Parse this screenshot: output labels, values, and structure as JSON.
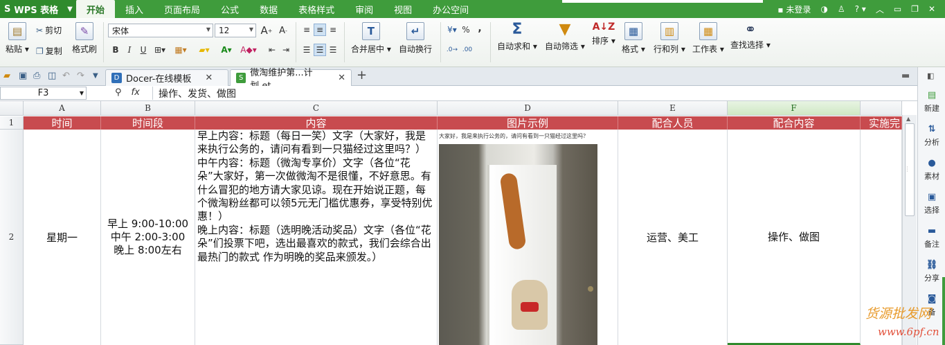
{
  "app": {
    "logo": "S",
    "name": "WPS 表格"
  },
  "menu": {
    "tabs": [
      "开始",
      "插入",
      "页面布局",
      "公式",
      "数据",
      "表格样式",
      "审阅",
      "视图",
      "办公空间"
    ],
    "active_index": 0,
    "login": "未登录",
    "help": "?"
  },
  "ribbon": {
    "paste": "粘贴",
    "cut": "剪切",
    "copy": "复制",
    "format_painter": "格式刷",
    "font_name": "宋体",
    "font_size": "12",
    "bold": "B",
    "italic": "I",
    "underline": "U",
    "merge_center": "合并居中",
    "wrap_text": "自动换行",
    "percent": "%",
    "comma": ",",
    "auto_sum": "自动求和",
    "auto_filter": "自动筛选",
    "sort": "排序",
    "format": "格式",
    "rows_cols": "行和列",
    "worksheet": "工作表",
    "find_select": "查找选择"
  },
  "doc_tabs": [
    {
      "label": "Docer-在线模板",
      "icon": "D",
      "color": "#2f6fb8"
    },
    {
      "label": "微淘维护第...计划.et",
      "icon": "S",
      "color": "#3f9c3c"
    }
  ],
  "formula_bar": {
    "cell_ref": "F3",
    "fx": "fx",
    "content": "操作、发货、做图"
  },
  "grid": {
    "columns": [
      "A",
      "B",
      "C",
      "D",
      "E",
      "F"
    ],
    "selected_column": "F",
    "row_numbers": [
      "1",
      "2"
    ],
    "header_row": [
      "时间",
      "时间段",
      "内容",
      "图片示例",
      "配合人员",
      "配合内容",
      "实施完"
    ],
    "header_color": "#c84b4f",
    "row2": {
      "day": "星期一",
      "times": [
        "早上 9:00-10:00",
        "中午 2:00-3:00",
        "晚上 8:00左右"
      ],
      "content": "早上内容：标题（每日一笑）文字（大家好，我是来执行公务的，请问有看到一只猫经过这里吗？）\n中午内容：标题（微淘专享价）文字（各位“花朵”大家好，第一次做微淘不是很懂，不好意思。有什么冒犯的地方请大家见谅。现在开始说正题，每个微淘粉丝都可以领5元无门槛优惠券，享受特别优惠！）\n晚上内容：标题（选明晚活动奖品）文字（各位“花朵”们投票下吧，选出最喜欢的款式，我们会综合出最热门的款式 作为明晚的奖品来颁发。）",
      "photo_caption": "大家好，我是来执行公务的，请问有看到一只猫经过这里吗？",
      "staff": "运营、美工",
      "task": "操作、做图"
    }
  },
  "sidebar": [
    "新建",
    "分析",
    "素材",
    "选择",
    "备注",
    "分享",
    "备"
  ],
  "watermark": {
    "text": "货源批发网",
    "url": "www.6pf.cn"
  }
}
